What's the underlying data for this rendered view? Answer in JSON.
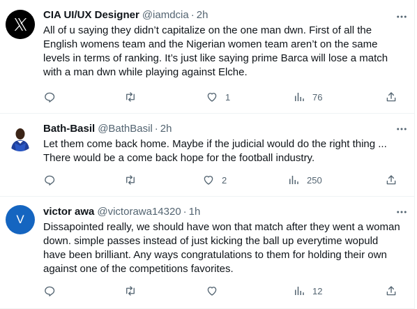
{
  "tweets": [
    {
      "name": "CIA UI/UX Designer",
      "handle": "@iamdcia",
      "separator": "·",
      "time": "2h",
      "text": "All of u saying they didn’t capitalize on the one man dwn. First of all the English womens team and the Nigerian women team aren’t on the same levels in terms of ranking. It’s just like saying prime Barca will lose a match with a man dwn while playing against Elche.",
      "replies": "",
      "retweets": "",
      "likes": "1",
      "views": "76"
    },
    {
      "name": "Bath-Basil",
      "handle": "@BathBasil",
      "separator": "·",
      "time": "2h",
      "text": "Let them come back home. Maybe if the judicial would do the right thing ... There would be a come back hope for the football industry.",
      "replies": "",
      "retweets": "",
      "likes": "2",
      "views": "250"
    },
    {
      "name": "victor awa",
      "handle": "@victorawa14320",
      "separator": "·",
      "time": "1h",
      "avatar_letter": "V",
      "text": "Dissapointed really, we should have won that match after they went a woman down. simple passes instead of just kicking the ball up everytime wopuld have been brilliant. Any ways congratulations to them for holding their own against one of the competitions favorites.",
      "replies": "",
      "retweets": "",
      "likes": "",
      "views": "12"
    }
  ],
  "colors": {
    "text": "#0f1419",
    "secondary": "#536471",
    "border": "#eff3f4",
    "avatar_v": "#1565c0"
  },
  "icons": [
    "x-logo-icon",
    "more-icon",
    "reply-icon",
    "retweet-icon",
    "like-icon",
    "views-icon",
    "share-icon"
  ]
}
